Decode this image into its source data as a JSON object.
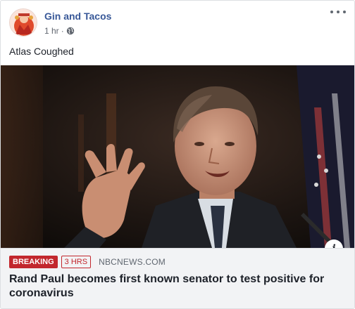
{
  "post": {
    "page_name": "Gin and Tacos",
    "time": "1 hr",
    "separator": "·",
    "privacy_icon": "globe-icon",
    "message": "Atlas Coughed"
  },
  "link": {
    "breaking_label": "BREAKING",
    "time_label": "3 HRS",
    "source": "NBCNEWS.COM",
    "headline": "Rand Paul becomes first known senator to test positive for coronavirus",
    "info_label": "i"
  },
  "colors": {
    "page_name": "#385898",
    "breaking": "#c2272d",
    "link_background": "#f2f3f5"
  }
}
